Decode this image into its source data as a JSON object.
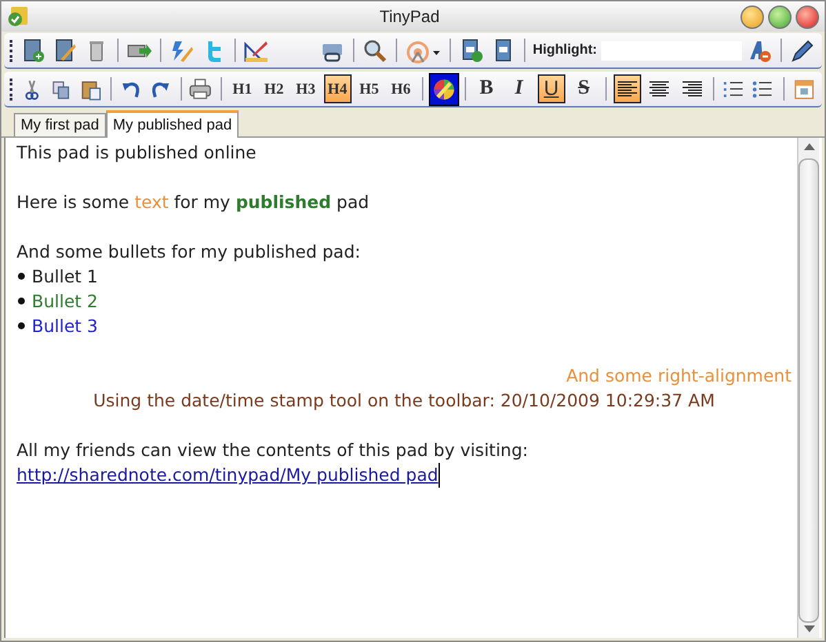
{
  "window": {
    "title": "TinyPad"
  },
  "toolbar": {
    "highlight_label": "Highlight:"
  },
  "format_bar": {
    "headings": [
      {
        "label": "H1",
        "selected": false
      },
      {
        "label": "H2",
        "selected": false
      },
      {
        "label": "H3",
        "selected": false
      },
      {
        "label": "H4",
        "selected": true
      },
      {
        "label": "H5",
        "selected": false
      },
      {
        "label": "H6",
        "selected": false
      }
    ],
    "color_tool_selected": true,
    "styles": [
      {
        "label": "B",
        "kind": "bold",
        "selected": false
      },
      {
        "label": "I",
        "kind": "italic",
        "selected": false
      },
      {
        "label": "U",
        "kind": "underline",
        "selected": true
      },
      {
        "label": "S",
        "kind": "strike",
        "selected": false
      }
    ],
    "alignments": [
      {
        "kind": "left",
        "selected": true
      },
      {
        "kind": "center",
        "selected": false
      },
      {
        "kind": "right",
        "selected": false
      }
    ]
  },
  "tabs": [
    {
      "label": "My first pad",
      "selected": false
    },
    {
      "label": "My published pad",
      "selected": true
    }
  ],
  "document": {
    "lines": [
      {
        "kind": "paragraph",
        "segments": [
          {
            "text": "This pad is published online"
          }
        ]
      },
      {
        "kind": "blank"
      },
      {
        "kind": "paragraph",
        "segments": [
          {
            "text": "Here is some "
          },
          {
            "text": "text",
            "color": "#e8903c"
          },
          {
            "text": " for my "
          },
          {
            "text": "published",
            "color": "#2e7d2e",
            "bold": true
          },
          {
            "text": " pad"
          }
        ]
      },
      {
        "kind": "blank"
      },
      {
        "kind": "paragraph",
        "segments": [
          {
            "text": "And some bullets for my published pad:"
          }
        ]
      },
      {
        "kind": "bullet",
        "segments": [
          {
            "text": "Bullet 1"
          }
        ]
      },
      {
        "kind": "bullet",
        "segments": [
          {
            "text": "Bullet 2",
            "color": "#2e7d2e"
          }
        ]
      },
      {
        "kind": "bullet",
        "segments": [
          {
            "text": "Bullet 3",
            "color": "#2222cc"
          }
        ]
      },
      {
        "kind": "blank"
      },
      {
        "kind": "right",
        "segments": [
          {
            "text": "And some right-alignment",
            "color": "#e8903c"
          }
        ]
      },
      {
        "kind": "center",
        "segments": [
          {
            "text": "Using the date/time stamp tool on the toolbar: 20/10/2009 10:29:37 AM",
            "color": "#7a3a1e"
          }
        ]
      },
      {
        "kind": "blank"
      },
      {
        "kind": "paragraph",
        "segments": [
          {
            "text": "All my friends can view the contents of this pad by visiting:"
          }
        ]
      },
      {
        "kind": "link",
        "segments": [
          {
            "text": "http://sharednote.com/tinypad/My published pad"
          }
        ]
      }
    ]
  }
}
